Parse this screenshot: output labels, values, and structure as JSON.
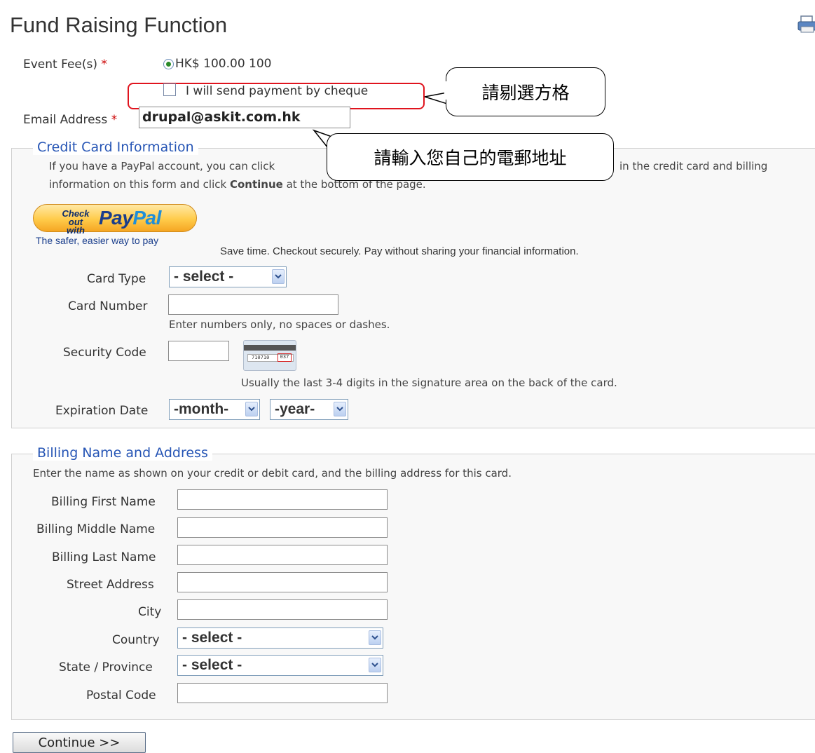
{
  "page": {
    "title": "Fund Raising Function"
  },
  "event": {
    "fee_label": "Event Fee(s)",
    "required_mark": "*",
    "fee_option": "HK$ 100.00 100",
    "cheque_label": "I will send payment by cheque",
    "email_label": "Email Address",
    "email_value": "drupal@askit.com.hk"
  },
  "callouts": {
    "checkbox_note": "請剔選方格",
    "email_note": "請輸入您自己的電郵地址"
  },
  "credit_card": {
    "legend": "Credit Card Information",
    "intro_line1_a": "If you have a PayPal account, you can click",
    "intro_line1_b": "in the credit card and billing",
    "intro_line2_a": "information on this form and click",
    "intro_line2_bold": "Continue",
    "intro_line2_b": "at the bottom of the page.",
    "paypal_check_out": "Check out",
    "paypal_with": "with",
    "paypal_pay": "Pay",
    "paypal_pal": "Pal",
    "paypal_tagline": "The safer, easier way to pay",
    "paypal_save": "Save time. Checkout securely. Pay without sharing your financial information.",
    "card_type_label": "Card Type",
    "card_type_value": "- select -",
    "card_number_label": "Card Number",
    "card_number_help": "Enter numbers only, no spaces or dashes.",
    "security_code_label": "Security Code",
    "security_code_help": "Usually the last 3-4 digits in the signature area on the back of the card.",
    "card_image_digits": "710710",
    "card_image_cvv": "037",
    "expiration_label": "Expiration Date",
    "month_value": "-month-",
    "year_value": "-year-"
  },
  "billing": {
    "legend": "Billing Name and Address",
    "intro": "Enter the name as shown on your credit or debit card, and the billing address for this card.",
    "first_name_label": "Billing First Name",
    "middle_name_label": "Billing Middle Name",
    "last_name_label": "Billing Last Name",
    "street_label": "Street Address",
    "city_label": "City",
    "country_label": "Country",
    "country_value": "- select -",
    "state_label": "State / Province",
    "state_value": "- select -",
    "postal_label": "Postal Code"
  },
  "actions": {
    "continue_label": "Continue >>"
  },
  "colors": {
    "legend": "#2655b5",
    "required": "#cc0000",
    "highlight_border": "#e0141e",
    "paypal_dark": "#1a3e8c",
    "paypal_light": "#1f8ed8"
  },
  "icons": {
    "printer": "printer-icon",
    "select_arrow": "chevron-down-icon",
    "card_back": "credit-card-back-icon"
  }
}
